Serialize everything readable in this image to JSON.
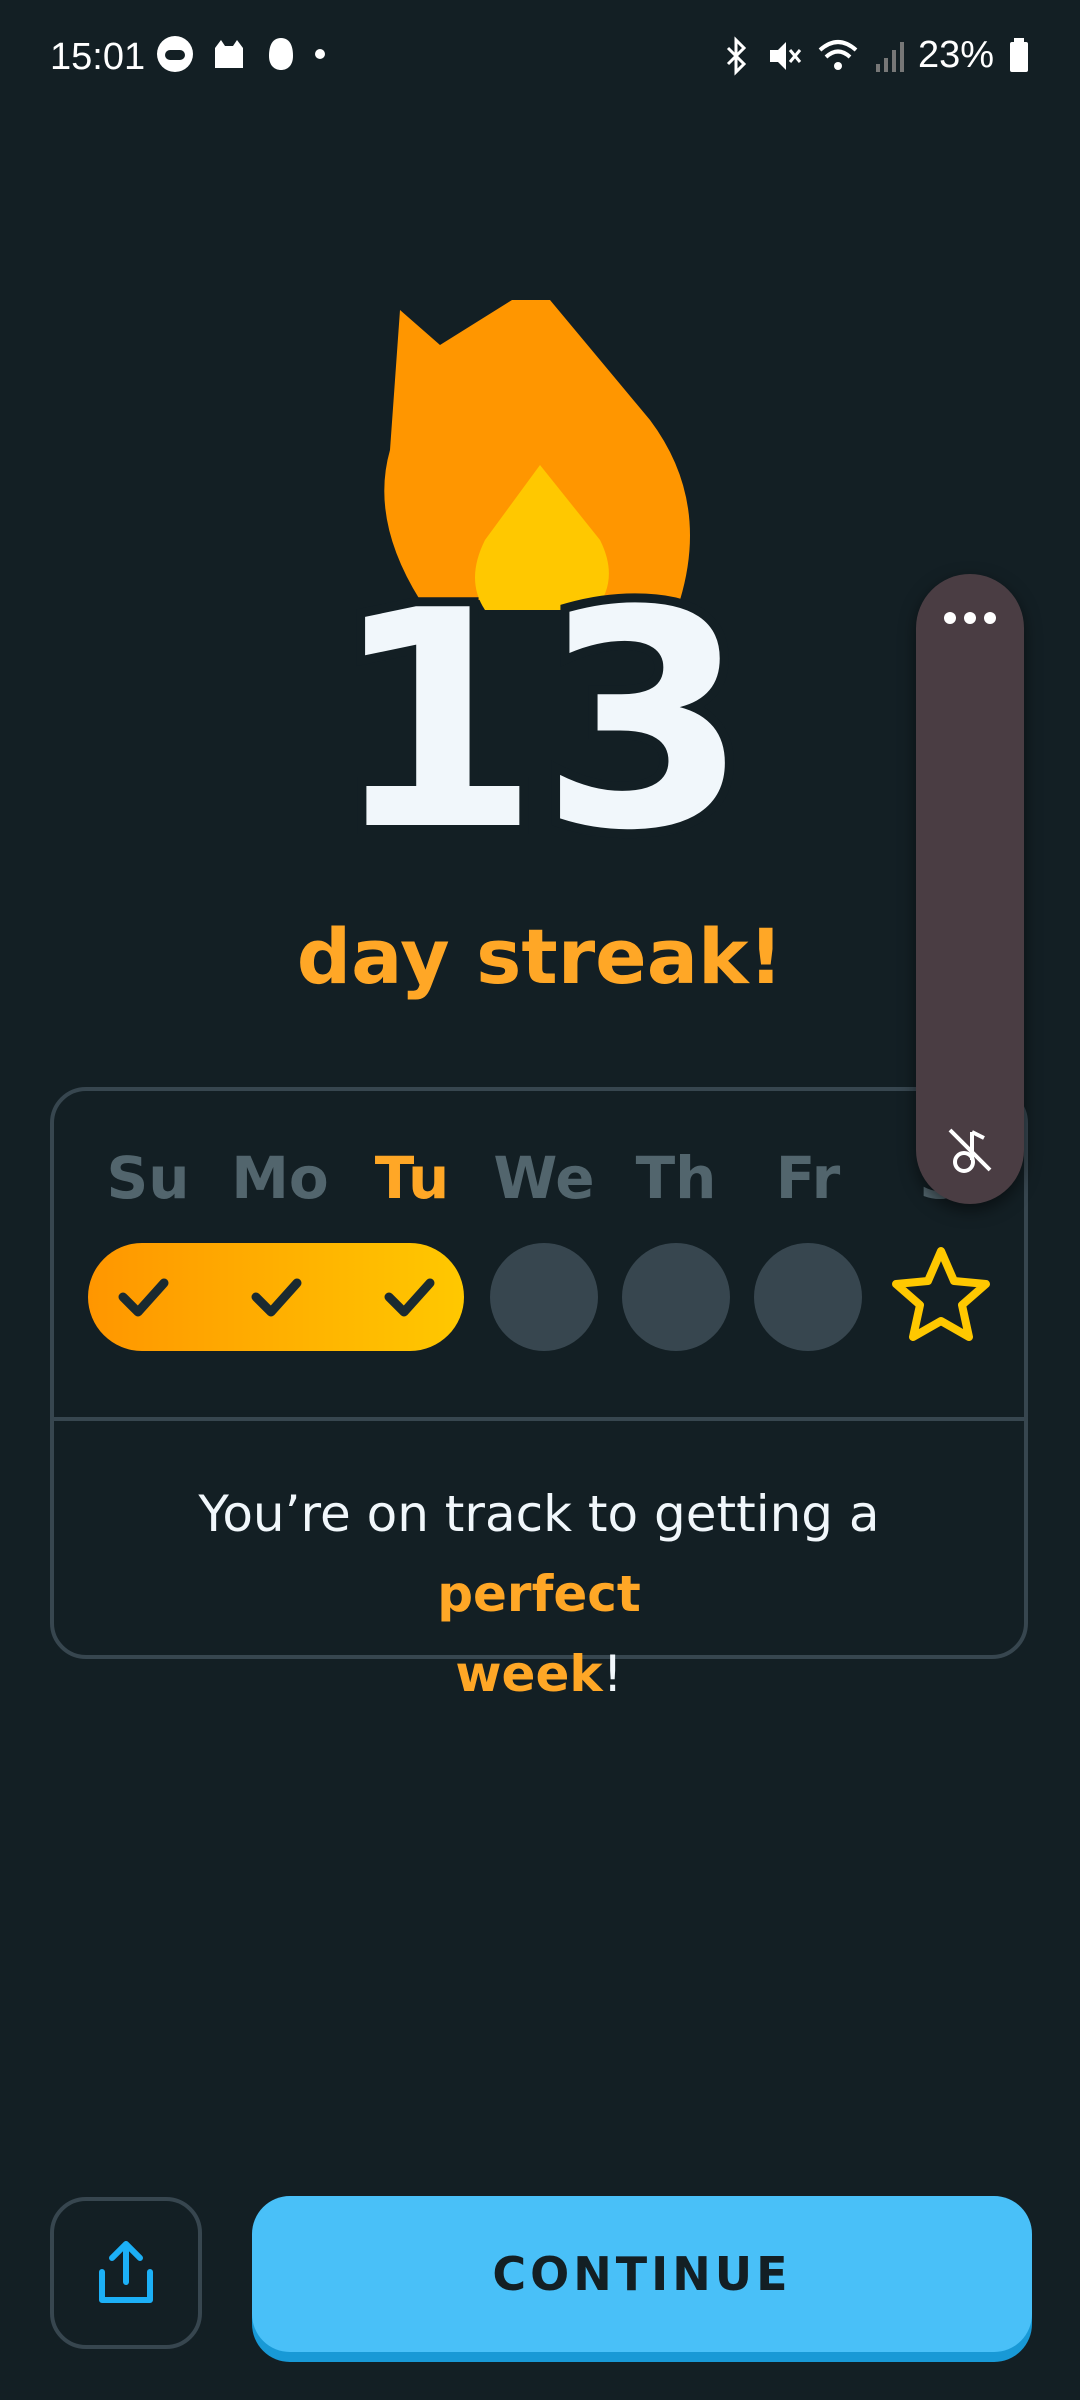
{
  "status_bar": {
    "time": "15:01",
    "battery": "23%",
    "left_icons": [
      "game-controller-icon",
      "cat-icon",
      "duolingo-owl-icon",
      "dot-icon"
    ],
    "right_icons": [
      "bluetooth-icon",
      "mute-icon",
      "wifi-icon",
      "signal-icon",
      "battery-icon"
    ]
  },
  "streak": {
    "count": "13",
    "label": "day streak!",
    "icon": "flame-icon"
  },
  "week": {
    "days": [
      {
        "label": "Su",
        "done": true
      },
      {
        "label": "Mo",
        "done": true
      },
      {
        "label": "Tu",
        "done": true,
        "today": true
      },
      {
        "label": "We",
        "done": false
      },
      {
        "label": "Th",
        "done": false
      },
      {
        "label": "Fr",
        "done": false
      },
      {
        "label": "S",
        "done": false,
        "goal": "star-icon"
      }
    ],
    "message_prefix": "You’re on track to getting a ",
    "message_highlight_1": "perfect",
    "message_highlight_2": "week",
    "message_suffix": "!"
  },
  "overlay": {
    "more_icon": "more-dots-icon",
    "mute_icon": "music-off-icon"
  },
  "buttons": {
    "share_icon": "share-icon",
    "continue_label": "CONTINUE"
  },
  "colors": {
    "background": "#131f24",
    "accent_orange": "#ffa726",
    "button_blue": "#49c0f8",
    "inactive": "#37464f"
  }
}
